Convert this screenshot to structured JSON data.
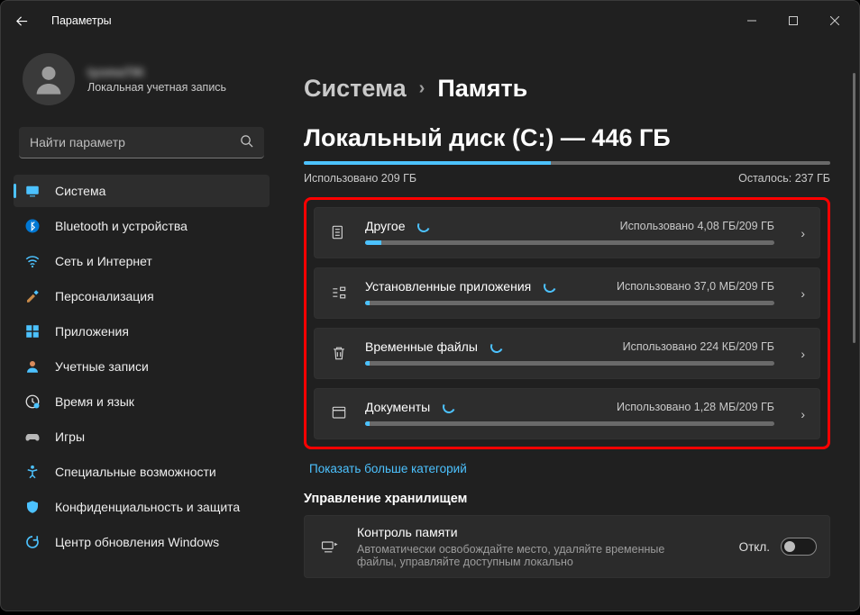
{
  "window": {
    "title": "Параметры"
  },
  "account": {
    "name": "tyomaTIK",
    "subtitle": "Локальная учетная запись"
  },
  "search": {
    "placeholder": "Найти параметр"
  },
  "sidebar": {
    "items": [
      {
        "label": "Система",
        "icon": "system"
      },
      {
        "label": "Bluetooth и устройства",
        "icon": "bluetooth"
      },
      {
        "label": "Сеть и Интернет",
        "icon": "wifi"
      },
      {
        "label": "Персонализация",
        "icon": "personalization"
      },
      {
        "label": "Приложения",
        "icon": "apps"
      },
      {
        "label": "Учетные записи",
        "icon": "accounts"
      },
      {
        "label": "Время и язык",
        "icon": "time"
      },
      {
        "label": "Игры",
        "icon": "gaming"
      },
      {
        "label": "Специальные возможности",
        "icon": "accessibility"
      },
      {
        "label": "Конфиденциальность и защита",
        "icon": "privacy"
      },
      {
        "label": "Центр обновления Windows",
        "icon": "update"
      }
    ],
    "selected_index": 0
  },
  "breadcrumb": {
    "parent": "Система",
    "current": "Память"
  },
  "disk": {
    "title": "Локальный диск (C:) — 446 ГБ",
    "used_label": "Использовано 209 ГБ",
    "free_label": "Осталось: 237 ГБ",
    "used_pct": 47
  },
  "categories": [
    {
      "title": "Другое",
      "used": "Использовано 4,08 ГБ/209 ГБ",
      "fill_pct": 4,
      "icon": "other"
    },
    {
      "title": "Установленные приложения",
      "used": "Использовано 37,0 МБ/209 ГБ",
      "fill_pct": 1,
      "icon": "installed"
    },
    {
      "title": "Временные файлы",
      "used": "Использовано 224 КБ/209 ГБ",
      "fill_pct": 1,
      "icon": "trash"
    },
    {
      "title": "Документы",
      "used": "Использовано 1,28 МБ/209 ГБ",
      "fill_pct": 1,
      "icon": "documents"
    }
  ],
  "show_more": "Показать больше категорий",
  "storage_mgmt": {
    "section_title": "Управление хранилищем",
    "sense_title": "Контроль памяти",
    "sense_sub": "Автоматически освобождайте место, удаляйте временные файлы, управляйте доступным локально",
    "state": "Откл."
  }
}
